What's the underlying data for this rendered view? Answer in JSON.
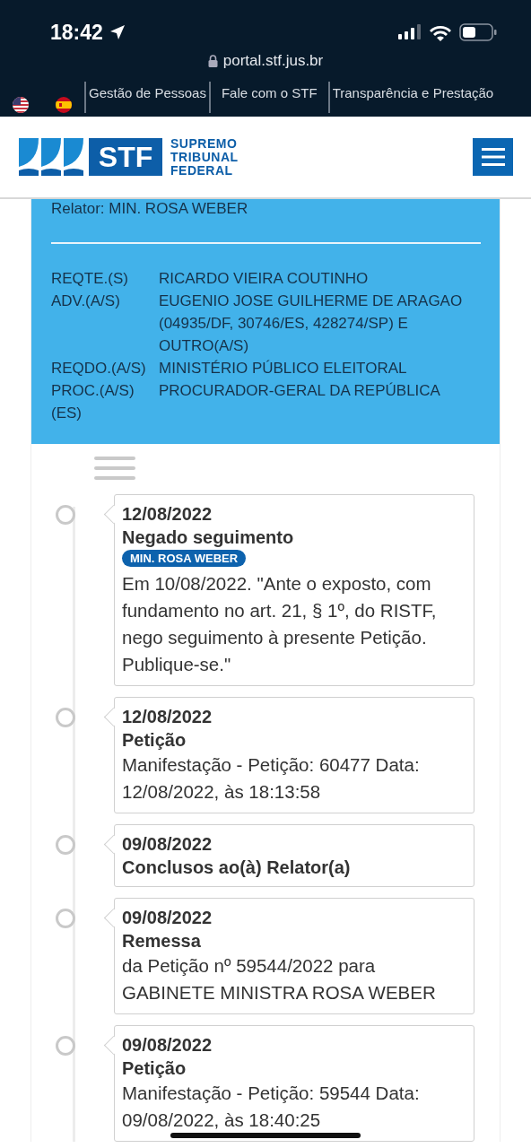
{
  "status_bar": {
    "time": "18:42"
  },
  "browser": {
    "url": "portal.stf.jus.br"
  },
  "top_links": [
    "Gestão de Pessoas",
    "Fale com o STF",
    "Transparência e Prestação"
  ],
  "logo": {
    "acronym": "STF",
    "name_lines": [
      "SUPREMO",
      "TRIBUNAL",
      "FEDERAL"
    ]
  },
  "case_panel": {
    "relator": "Relator: MIN. ROSA WEBER",
    "parties": [
      {
        "label": "REQTE.(S)",
        "value": "RICARDO VIEIRA COUTINHO"
      },
      {
        "label": "ADV.(A/S)",
        "value": "EUGENIO JOSE GUILHERME DE ARAGAO (04935/DF, 30746/ES, 428274/SP) E OUTRO(A/S)"
      },
      {
        "label": "REQDO.(A/S)",
        "value": "MINISTÉRIO PÚBLICO ELEITORAL"
      },
      {
        "label": "PROC.(A/S)(ES)",
        "value": "PROCURADOR-GERAL DA REPÚBLICA"
      }
    ]
  },
  "timeline": [
    {
      "date": "12/08/2022",
      "title": "Negado seguimento",
      "badge": "MIN. ROSA WEBER",
      "text": "Em 10/08/2022. \"Ante o exposto, com fundamento no art. 21, § 1º, do RISTF, nego seguimento à presente Petição. Publique-se.\""
    },
    {
      "date": "12/08/2022",
      "title": "Petição",
      "text": "Manifestação - Petição: 60477 Data: 12/08/2022, às 18:13:58"
    },
    {
      "date": "09/08/2022",
      "title": "Conclusos ao(à) Relator(a)"
    },
    {
      "date": "09/08/2022",
      "title": "Remessa",
      "text": "da Petição nº 59544/2022 para GABINETE MINISTRA ROSA WEBER"
    },
    {
      "date": "09/08/2022",
      "title": "Petição",
      "text": "Manifestação - Petição: 59544 Data: 09/08/2022, às 18:40:25"
    }
  ]
}
